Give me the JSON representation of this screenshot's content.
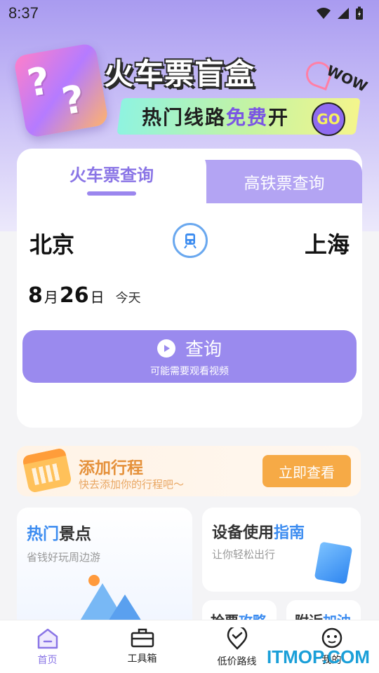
{
  "status_bar": {
    "time": "8:37"
  },
  "banner": {
    "title": "火车票盲盒",
    "subtitle_pre": "热门线路",
    "subtitle_highlight": "免费",
    "subtitle_post": "开",
    "go_label": "GO",
    "wow_label": "WOW"
  },
  "tabs": [
    {
      "label": "火车票查询",
      "active": true
    },
    {
      "label": "高铁票查询",
      "active": false
    }
  ],
  "search": {
    "from_city": "北京",
    "to_city": "上海",
    "month": "8",
    "month_unit": "月",
    "day": "26",
    "day_unit": "日",
    "relative_day": "今天",
    "query_label": "查询",
    "query_sub": "可能需要观看视频"
  },
  "trip": {
    "title": "添加行程",
    "subtitle": "快去添加你的行程吧～",
    "button": "立即查看"
  },
  "cards": {
    "scenic": {
      "title_highlight": "热门",
      "title_rest": "景点",
      "subtitle": "省钱好玩周边游"
    },
    "guide": {
      "title_rest": "设备使用",
      "title_highlight": "指南",
      "subtitle": "让你轻松出行"
    },
    "mini1": {
      "title_rest": "抢票",
      "title_highlight": "攻略"
    },
    "mini2": {
      "title_rest": "附近",
      "title_highlight": "加油"
    }
  },
  "nav": [
    {
      "label": "首页",
      "icon": "home-icon",
      "active": true
    },
    {
      "label": "工具箱",
      "icon": "toolbox-icon",
      "active": false
    },
    {
      "label": "低价路线",
      "icon": "location-check-icon",
      "active": false
    },
    {
      "label": "我的",
      "icon": "smiley-icon",
      "active": false
    }
  ],
  "watermark": "ITMOP.COM",
  "colors": {
    "accent": "#9a8aee",
    "orange": "#f6aa46",
    "blue": "#3c8cf0"
  }
}
